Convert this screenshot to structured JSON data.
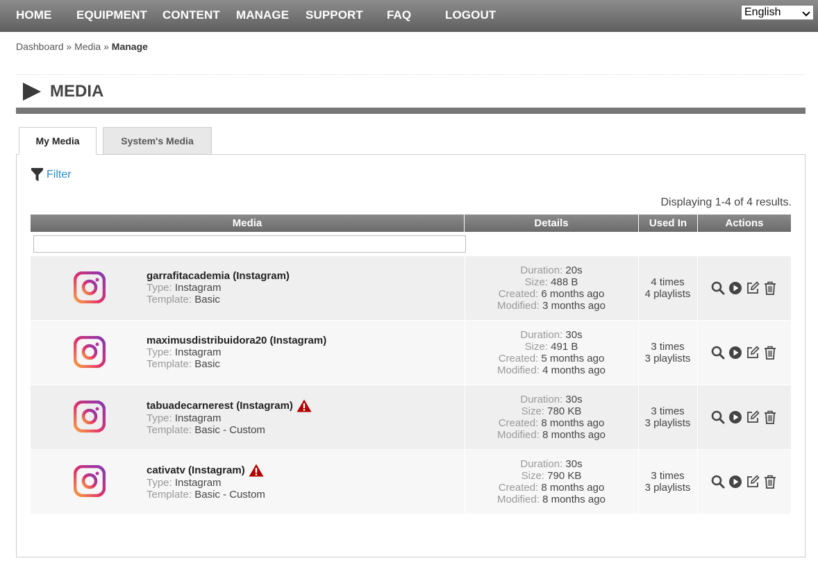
{
  "nav": {
    "items": [
      "HOME",
      "EQUIPMENT",
      "CONTENT",
      "MANAGE",
      "SUPPORT",
      "FAQ",
      "LOGOUT"
    ],
    "language": "English"
  },
  "breadcrumb": {
    "dashboard": "Dashboard",
    "sep": "»",
    "media": "Media",
    "current": "Manage"
  },
  "page": {
    "title": "MEDIA"
  },
  "tabs": [
    "My Media",
    "System's Media"
  ],
  "filter_label": "Filter",
  "summary": "Displaying 1-4 of 4 results.",
  "table": {
    "headers": [
      "Media",
      "Details",
      "Used In",
      "Actions"
    ],
    "labels": {
      "type": "Type:",
      "template": "Template:",
      "duration": "Duration:",
      "size": "Size:",
      "created": "Created:",
      "modified": "Modified:"
    },
    "rows": [
      {
        "name": "garrafitacademia (Instagram)",
        "warning": false,
        "type": "Instagram",
        "template": "Basic",
        "duration": "20s",
        "size": "488 B",
        "created": "6 months ago",
        "modified": "3 months ago",
        "times": "4 times",
        "playlists": "4 playlists"
      },
      {
        "name": "maximusdistribuidora20 (Instagram)",
        "warning": false,
        "type": "Instagram",
        "template": "Basic",
        "duration": "30s",
        "size": "491 B",
        "created": "5 months ago",
        "modified": "4 months ago",
        "times": "3 times",
        "playlists": "3 playlists"
      },
      {
        "name": "tabuadecarnerest (Instagram)",
        "warning": true,
        "type": "Instagram",
        "template": "Basic - Custom",
        "duration": "30s",
        "size": "780 KB",
        "created": "8 months ago",
        "modified": "8 months ago",
        "times": "3 times",
        "playlists": "3 playlists"
      },
      {
        "name": "cativatv (Instagram)",
        "warning": true,
        "type": "Instagram",
        "template": "Basic - Custom",
        "duration": "30s",
        "size": "790 KB",
        "created": "8 months ago",
        "modified": "8 months ago",
        "times": "3 times",
        "playlists": "3 playlists"
      }
    ]
  },
  "colors": {
    "link": "#2a8ac9",
    "warning": "#b30000",
    "header": "#777777"
  },
  "icons": [
    "instagram-icon",
    "warning-icon",
    "search-icon",
    "play-icon",
    "edit-icon",
    "trash-icon",
    "filter-icon"
  ]
}
